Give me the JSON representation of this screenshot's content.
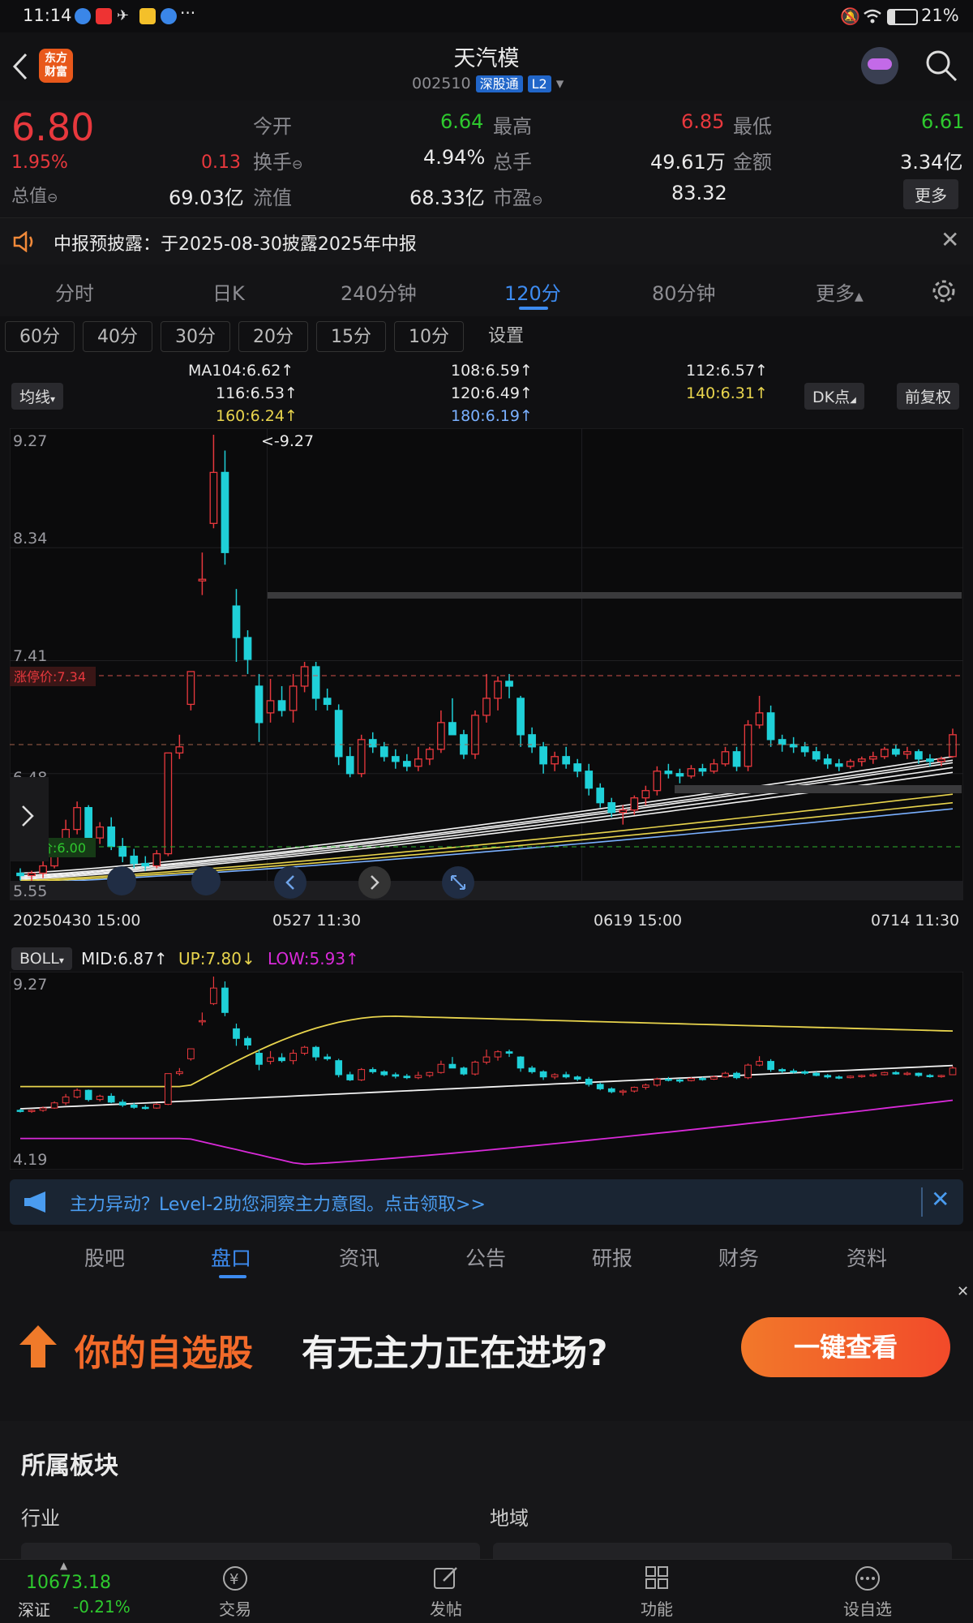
{
  "status": {
    "time": "11:14",
    "battery": "21%"
  },
  "header": {
    "logo_line1": "东方",
    "logo_line2": "财富",
    "title": "天汽模",
    "code": "002510",
    "tag": "深股通",
    "level": "L2"
  },
  "quote": {
    "price": "6.80",
    "change_pct": "1.95%",
    "change": "0.13",
    "open_label": "今开",
    "open": "6.64",
    "high_label": "最高",
    "high": "6.85",
    "low_label": "最低",
    "low": "6.61",
    "turnover_label": "换手",
    "turnover": "4.94%",
    "volume_label": "总手",
    "volume": "49.61万",
    "amount_label": "金额",
    "amount": "3.34亿",
    "mcap_label": "总值",
    "mcap": "69.03亿",
    "float_label": "流值",
    "float": "68.33亿",
    "pe_label": "市盈",
    "pe": "83.32",
    "more": "更多"
  },
  "notice": {
    "text": "中报预披露：于2025-08-30披露2025年中报"
  },
  "period_tabs": [
    {
      "label": "分时"
    },
    {
      "label": "日K"
    },
    {
      "label": "240分钟"
    },
    {
      "label": "120分"
    },
    {
      "label": "80分钟"
    },
    {
      "label": "更多"
    }
  ],
  "sub_tabs": [
    {
      "label": "60分"
    },
    {
      "label": "40分"
    },
    {
      "label": "30分"
    },
    {
      "label": "20分"
    },
    {
      "label": "15分"
    },
    {
      "label": "10分"
    },
    {
      "label": "设置"
    }
  ],
  "ma_legend": {
    "selector": "均线",
    "ma104": "MA104:6.62↑",
    "ma108": "108:6.59↑",
    "ma112": "112:6.57↑",
    "ma116": "116:6.53↑",
    "ma120": "120:6.49↑",
    "ma140": "140:6.31↑",
    "ma160": "160:6.24↑",
    "ma180": "180:6.19↑",
    "dk": "DK点",
    "adjust": "前复权"
  },
  "chart_labels": {
    "y_9_27": "9.27",
    "y_8_34": "8.34",
    "y_7_41": "7.41",
    "y_6_48": "6.48",
    "y_5_55": "5.55",
    "peak": "<-9.27",
    "limit_up": "涨停价:7.34",
    "limit_down": "跌停价:6.00",
    "x1": "20250430 15:00",
    "x2": "0527 11:30",
    "x3": "0619 15:00",
    "x4": "0714 11:30"
  },
  "colors": {
    "up": "#e8383d",
    "down": "#1fd0d8",
    "ma_white": "#f2f2f2",
    "ma_yellow": "#e8d44d",
    "ma_blue": "#7ab0ff",
    "boll_low": "#d92ad9"
  },
  "chart_data": {
    "type": "candlestick",
    "y_range": [
      5.55,
      9.27
    ],
    "candles": [
      [
        5.66,
        5.7,
        5.6,
        5.64
      ],
      [
        5.64,
        5.68,
        5.59,
        5.66
      ],
      [
        5.66,
        5.76,
        5.62,
        5.72
      ],
      [
        5.72,
        5.9,
        5.7,
        5.86
      ],
      [
        5.86,
        6.1,
        5.8,
        6.02
      ],
      [
        6.02,
        6.25,
        5.98,
        6.2
      ],
      [
        6.2,
        6.22,
        5.9,
        5.95
      ],
      [
        5.95,
        6.08,
        5.9,
        6.04
      ],
      [
        6.04,
        6.12,
        5.85,
        5.88
      ],
      [
        5.88,
        5.95,
        5.75,
        5.8
      ],
      [
        5.8,
        5.86,
        5.7,
        5.74
      ],
      [
        5.74,
        5.8,
        5.68,
        5.72
      ],
      [
        5.72,
        5.85,
        5.7,
        5.82
      ],
      [
        5.82,
        6.65,
        5.8,
        6.65
      ],
      [
        6.65,
        6.8,
        6.6,
        6.7
      ],
      [
        7.05,
        7.32,
        7.0,
        7.32
      ],
      [
        8.08,
        8.3,
        7.95,
        8.08
      ],
      [
        8.54,
        9.27,
        8.5,
        8.96
      ],
      [
        8.96,
        9.14,
        8.2,
        8.3
      ],
      [
        7.86,
        8.0,
        7.4,
        7.6
      ],
      [
        7.6,
        7.66,
        7.3,
        7.42
      ],
      [
        7.2,
        7.3,
        6.74,
        6.9
      ],
      [
        6.98,
        7.26,
        6.9,
        7.08
      ],
      [
        7.08,
        7.2,
        6.95,
        7.0
      ],
      [
        7.0,
        7.3,
        6.9,
        7.2
      ],
      [
        7.2,
        7.4,
        7.15,
        7.36
      ],
      [
        7.36,
        7.4,
        7.0,
        7.1
      ],
      [
        7.1,
        7.18,
        7.0,
        7.05
      ],
      [
        7.0,
        7.05,
        6.55,
        6.62
      ],
      [
        6.62,
        6.7,
        6.45,
        6.48
      ],
      [
        6.48,
        6.8,
        6.45,
        6.76
      ],
      [
        6.76,
        6.82,
        6.65,
        6.7
      ],
      [
        6.7,
        6.74,
        6.58,
        6.62
      ],
      [
        6.62,
        6.68,
        6.52,
        6.58
      ],
      [
        6.58,
        6.64,
        6.5,
        6.54
      ],
      [
        6.54,
        6.7,
        6.5,
        6.6
      ],
      [
        6.6,
        6.7,
        6.55,
        6.68
      ],
      [
        6.68,
        7.0,
        6.65,
        6.9
      ],
      [
        6.9,
        7.1,
        6.85,
        6.8
      ],
      [
        6.8,
        6.84,
        6.6,
        6.64
      ],
      [
        6.64,
        7.0,
        6.6,
        6.96
      ],
      [
        6.96,
        7.3,
        6.9,
        7.1
      ],
      [
        7.1,
        7.28,
        7.0,
        7.24
      ],
      [
        7.24,
        7.3,
        7.1,
        7.2
      ],
      [
        7.1,
        7.12,
        6.7,
        6.8
      ],
      [
        6.8,
        6.86,
        6.65,
        6.7
      ],
      [
        6.7,
        6.74,
        6.48,
        6.56
      ],
      [
        6.56,
        6.66,
        6.5,
        6.62
      ],
      [
        6.62,
        6.7,
        6.52,
        6.56
      ],
      [
        6.56,
        6.6,
        6.45,
        6.5
      ],
      [
        6.5,
        6.56,
        6.3,
        6.36
      ],
      [
        6.36,
        6.4,
        6.2,
        6.24
      ],
      [
        6.24,
        6.28,
        6.12,
        6.16
      ],
      [
        6.16,
        6.22,
        6.06,
        6.18
      ],
      [
        6.18,
        6.3,
        6.14,
        6.28
      ],
      [
        6.28,
        6.38,
        6.22,
        6.34
      ],
      [
        6.34,
        6.54,
        6.3,
        6.5
      ],
      [
        6.5,
        6.56,
        6.44,
        6.48
      ],
      [
        6.48,
        6.52,
        6.4,
        6.46
      ],
      [
        6.46,
        6.55,
        6.44,
        6.52
      ],
      [
        6.52,
        6.56,
        6.46,
        6.5
      ],
      [
        6.5,
        6.6,
        6.48,
        6.56
      ],
      [
        6.56,
        6.7,
        6.54,
        6.66
      ],
      [
        6.66,
        6.7,
        6.5,
        6.54
      ],
      [
        6.54,
        6.92,
        6.5,
        6.88
      ],
      [
        6.88,
        7.12,
        6.85,
        6.98
      ],
      [
        6.98,
        7.04,
        6.7,
        6.76
      ],
      [
        6.76,
        6.8,
        6.66,
        6.72
      ],
      [
        6.72,
        6.78,
        6.65,
        6.7
      ],
      [
        6.7,
        6.74,
        6.62,
        6.66
      ],
      [
        6.66,
        6.7,
        6.58,
        6.6
      ],
      [
        6.6,
        6.64,
        6.52,
        6.56
      ],
      [
        6.56,
        6.6,
        6.5,
        6.54
      ],
      [
        6.54,
        6.6,
        6.52,
        6.58
      ],
      [
        6.58,
        6.62,
        6.54,
        6.6
      ],
      [
        6.6,
        6.66,
        6.56,
        6.62
      ],
      [
        6.62,
        6.7,
        6.6,
        6.68
      ],
      [
        6.68,
        6.72,
        6.62,
        6.64
      ],
      [
        6.64,
        6.7,
        6.6,
        6.66
      ],
      [
        6.66,
        6.68,
        6.56,
        6.6
      ],
      [
        6.6,
        6.64,
        6.54,
        6.58
      ],
      [
        6.58,
        6.62,
        6.54,
        6.6
      ],
      [
        6.62,
        6.85,
        6.61,
        6.8
      ]
    ],
    "ma_series": [
      {
        "name": "MA104",
        "color": "#f2f2f2",
        "start": 5.66,
        "end": 6.62
      },
      {
        "name": "108",
        "color": "#f2f2f2",
        "start": 5.64,
        "end": 6.59
      },
      {
        "name": "112",
        "color": "#f2f2f2",
        "start": 5.63,
        "end": 6.57
      },
      {
        "name": "116",
        "color": "#f2f2f2",
        "start": 5.62,
        "end": 6.53
      },
      {
        "name": "120",
        "color": "#f2f2f2",
        "start": 5.61,
        "end": 6.49
      },
      {
        "name": "140",
        "color": "#e8d44d",
        "start": 5.6,
        "end": 6.31
      },
      {
        "name": "160",
        "color": "#e8d44d",
        "start": 5.59,
        "end": 6.24
      },
      {
        "name": "180",
        "color": "#7ab0ff",
        "start": 5.58,
        "end": 6.19
      }
    ]
  },
  "boll": {
    "selector": "BOLL",
    "mid": "MID:6.87↑",
    "up": "UP:7.80↓",
    "low": "LOW:5.93↑",
    "y_top": "9.27",
    "y_bottom": "4.19"
  },
  "l2banner": {
    "text": "主力异动？Level-2助您洞察主力意图。点击领取>>"
  },
  "bottom_tabs": [
    {
      "label": "股吧"
    },
    {
      "label": "盘口"
    },
    {
      "label": "资讯"
    },
    {
      "label": "公告"
    },
    {
      "label": "研报"
    },
    {
      "label": "财务"
    },
    {
      "label": "资料"
    }
  ],
  "ad": {
    "highlight": "你的自选股",
    "text": "有无主力正在进场?",
    "button": "一键查看"
  },
  "sector": {
    "title": "所属板块",
    "industry": "行业",
    "region": "地域"
  },
  "bottom_nav": {
    "index_value": "10673.18",
    "index_name": "深证",
    "index_change": "-0.21%",
    "trade": "交易",
    "post": "发帖",
    "func": "功能",
    "watch": "设自选"
  }
}
